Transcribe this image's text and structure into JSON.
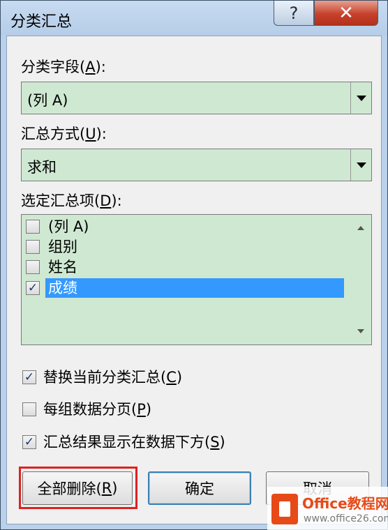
{
  "window": {
    "title": "分类汇总",
    "help_glyph": "?",
    "close_glyph": "✕"
  },
  "field_label": {
    "text": "分类字段(",
    "key": "A",
    "suffix": "):"
  },
  "field_combo": {
    "value": "(列 A)"
  },
  "method_label": {
    "text": "汇总方式(",
    "key": "U",
    "suffix": "):"
  },
  "method_combo": {
    "value": "求和"
  },
  "items_label": {
    "text": "选定汇总项(",
    "key": "D",
    "suffix": "):"
  },
  "items": [
    {
      "label": "(列 A)",
      "checked": false,
      "selected": false
    },
    {
      "label": "组别",
      "checked": false,
      "selected": false
    },
    {
      "label": "姓名",
      "checked": false,
      "selected": false
    },
    {
      "label": "成绩",
      "checked": true,
      "selected": true
    }
  ],
  "options": [
    {
      "text": "替换当前分类汇总(",
      "key": "C",
      "suffix": ")",
      "checked": true
    },
    {
      "text": "每组数据分页(",
      "key": "P",
      "suffix": ")",
      "checked": false
    },
    {
      "text": "汇总结果显示在数据下方(",
      "key": "S",
      "suffix": ")",
      "checked": true
    }
  ],
  "buttons": {
    "remove_all": {
      "text": "全部删除(",
      "key": "R",
      "suffix": ")"
    },
    "ok": "确定",
    "cancel": "取消"
  },
  "check_glyph": "✓",
  "colors": {
    "combo_bg": "#cfe8d2",
    "selection": "#3399ff",
    "highlight_frame": "#e02020",
    "title_bar": "#b9d1ea",
    "close_button": "#c5412b"
  },
  "watermark": {
    "title": "Office教程网",
    "url": "www.office26.com"
  }
}
